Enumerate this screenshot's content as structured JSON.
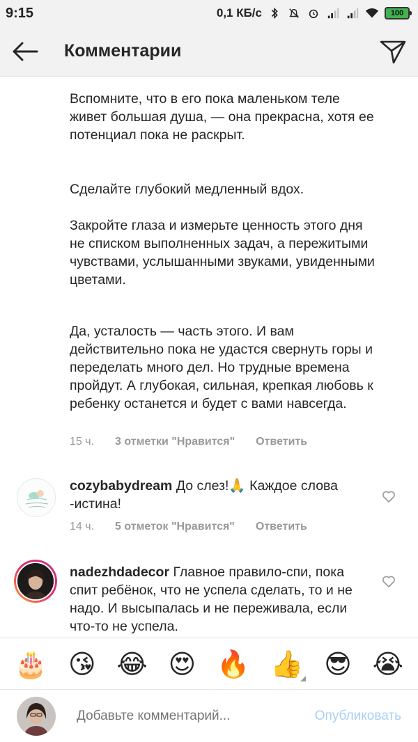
{
  "status_bar": {
    "time": "9:15",
    "network_speed": "0,1 КБ/с",
    "battery": "100",
    "icons": [
      "bluetooth-icon",
      "alarm-off-icon",
      "alarm-icon",
      "signal-icon",
      "signal-icon",
      "wifi-icon",
      "battery-icon"
    ]
  },
  "header": {
    "title": "Комментарии",
    "back_icon": "arrow-left-icon",
    "send_icon": "direct-send-icon"
  },
  "caption": {
    "paragraphs": [
      "Вспомните, что в его пока маленьком теле живет большая душа, — она прекрасна, хотя ее потенциал пока не раскрыт.",
      "Сделайте глубокий медленный вдох.",
      "Закройте глаза и измерьте ценность этого дня не списком выполненных задач, а пережитыми чувствами, услышанными звуками, увиденными цветами.",
      "Да, усталость — часть этого. И вам действительно пока не удастся свернуть горы и переделать много дел. Но трудные времена пройдут. А глубокая, сильная, крепкая любовь к ребенку останется и будет с вами навсегда."
    ],
    "time": "15 ч.",
    "likes": "3 отметки \"Нравится\"",
    "reply": "Ответить"
  },
  "comments": [
    {
      "username": "cozybabydream",
      "text": "До слез!🙏 Каждое слова -истина!",
      "time": "14 ч.",
      "likes": "5 отметок \"Нравится\"",
      "reply": "Ответить"
    },
    {
      "username": "nadezhdadecor",
      "text": "Главное правило-спи, пока спит ребёнок, что не успела сделать, то и не надо. И высыпалась и не переживала, если что-то не успела."
    }
  ],
  "emoji_bar": [
    "🎂",
    "😘",
    "😂",
    "😍",
    "🔥",
    "👍",
    "😎",
    "😭"
  ],
  "comment_box": {
    "placeholder": "Добавьте комментарий...",
    "publish_label": "Опубликовать"
  },
  "colors": {
    "bar_background": "#f2f2f2",
    "text": "#262626",
    "meta_text": "#999999",
    "publish_disabled": "#a7d0f4",
    "story_ring": "#c13584",
    "battery": "#3fb34f"
  }
}
